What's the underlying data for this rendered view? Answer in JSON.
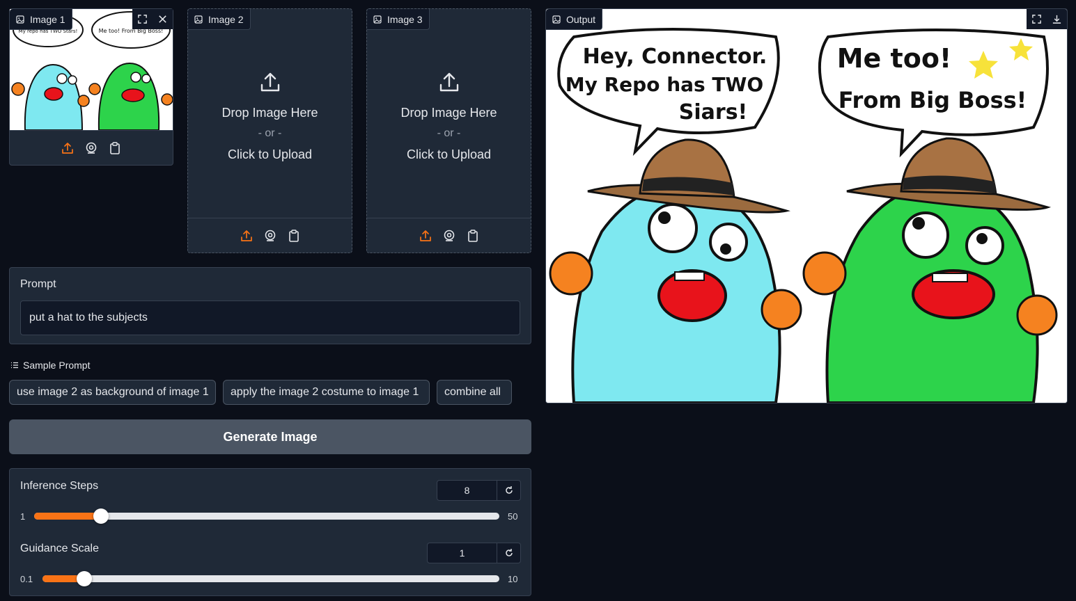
{
  "inputs": {
    "image1": {
      "label": "Image 1",
      "bubble_left": "My repo has TWO Stars!",
      "bubble_right": "Me too! From Big Boss!"
    },
    "image2": {
      "label": "Image 2",
      "drop_text": "Drop Image Here",
      "or_text": "- or -",
      "click_text": "Click to Upload"
    },
    "image3": {
      "label": "Image 3",
      "drop_text": "Drop Image Here",
      "or_text": "- or -",
      "click_text": "Click to Upload"
    }
  },
  "prompt": {
    "label": "Prompt",
    "value": "put a hat to the subjects"
  },
  "samples": {
    "label": "Sample Prompt",
    "items": [
      "use image 2 as background of image 1",
      "apply the image 2 costume to image 1",
      "combine all"
    ]
  },
  "generate": {
    "label": "Generate Image"
  },
  "sliders": {
    "steps": {
      "label": "Inference Steps",
      "value": "8",
      "min": "1",
      "max": "50",
      "fraction": 0.143
    },
    "guidance": {
      "label": "Guidance Scale",
      "value": "1",
      "min": "0.1",
      "max": "10",
      "fraction": 0.091
    }
  },
  "output": {
    "label": "Output",
    "bubble_left_1": "Hey, Connector.",
    "bubble_left_2": "My Repo has TWO",
    "bubble_left_3": "Siars!",
    "bubble_right_1": "Me too!",
    "bubble_right_2": "From Big Boss!"
  },
  "icons": [
    "image-icon",
    "upload-icon",
    "webcam-icon",
    "clipboard-icon",
    "fullscreen-icon",
    "close-icon",
    "download-icon",
    "reset-icon",
    "list-icon"
  ],
  "colors": {
    "accent": "#f97316",
    "background": "#0b0f19",
    "panel": "#1f2937",
    "button": "#4b5563"
  }
}
